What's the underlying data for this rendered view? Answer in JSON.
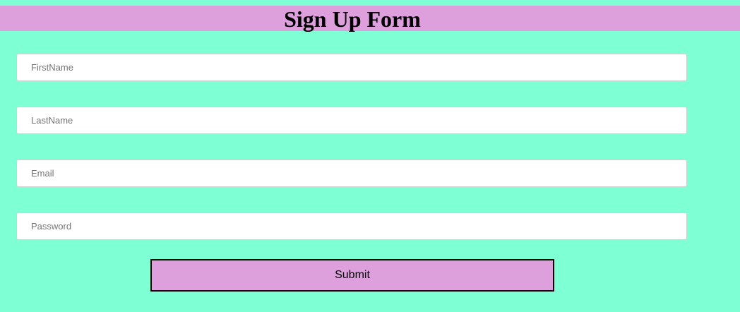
{
  "header": {
    "title": "Sign Up Form"
  },
  "form": {
    "first_name": {
      "value": "",
      "placeholder": "FirstName"
    },
    "last_name": {
      "value": "",
      "placeholder": "LastName"
    },
    "email": {
      "value": "",
      "placeholder": "Email"
    },
    "password": {
      "value": "",
      "placeholder": "Password"
    },
    "submit_label": "Submit"
  },
  "colors": {
    "page_background": "#7fffd4",
    "header_background": "#dda0dd",
    "button_background": "#dda0dd"
  }
}
